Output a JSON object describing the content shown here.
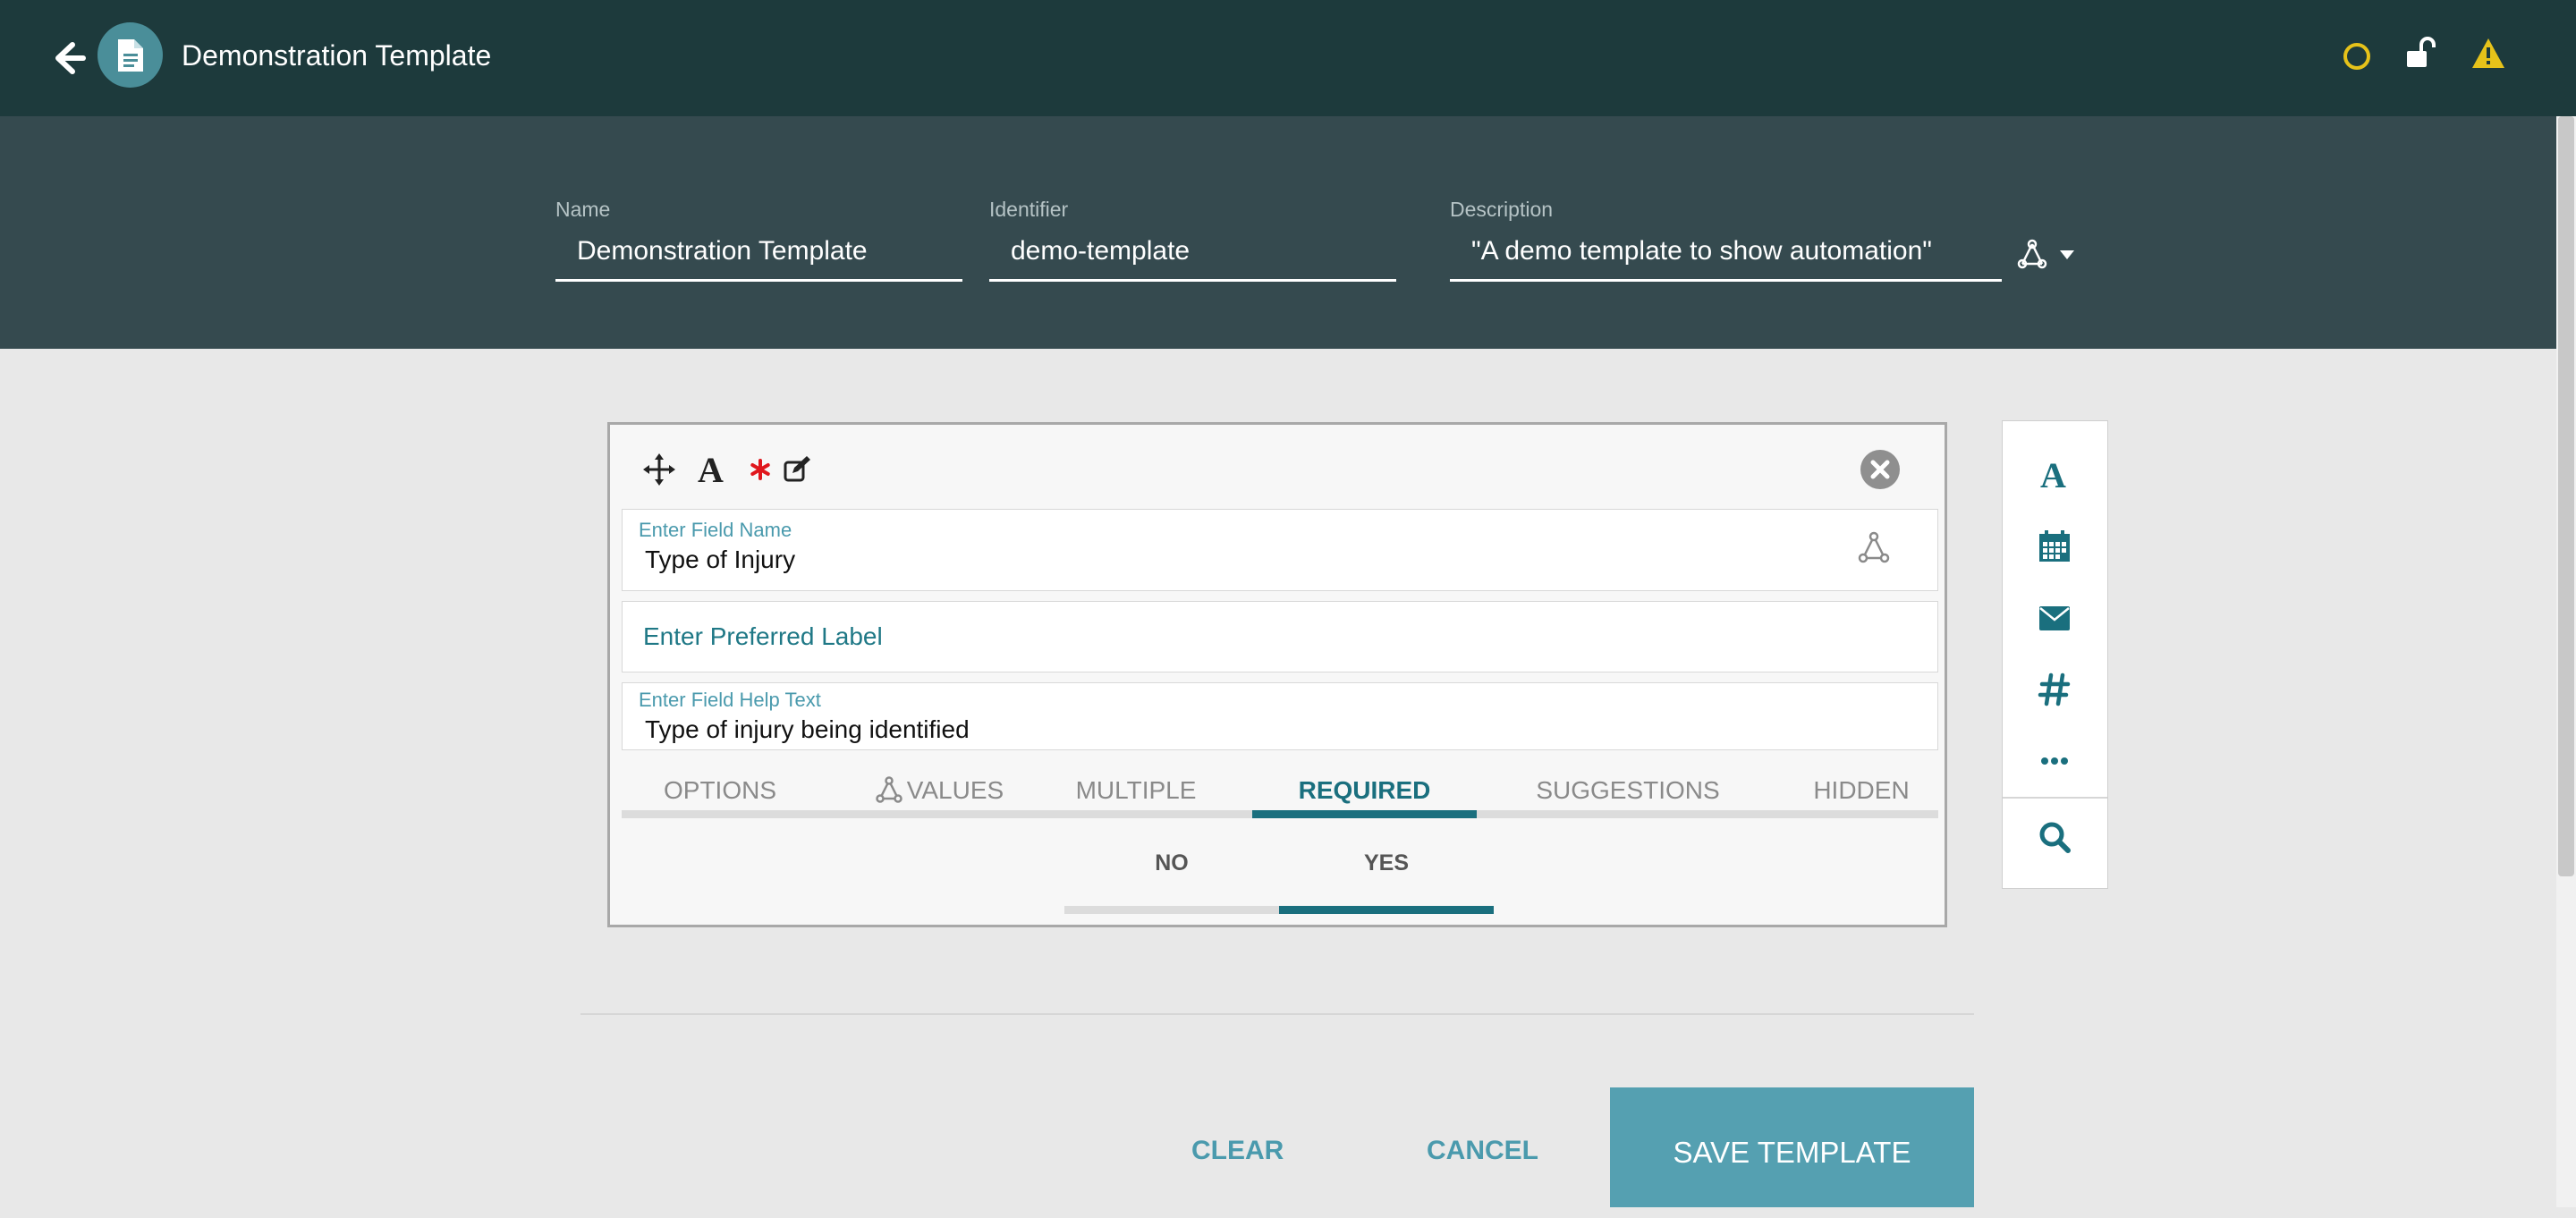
{
  "app": {
    "title": "Demonstration Template",
    "icons": {
      "back": "back-arrow-icon",
      "document": "document-icon",
      "status": "circle-icon",
      "lock": "unlocked-lock-icon",
      "warning": "warning-icon"
    },
    "colors": {
      "topbar": "#1d3a3c",
      "band": "#354a4f",
      "accent": "#1a6f7e",
      "warning": "#e6c21a",
      "button": "#55a0b1"
    }
  },
  "meta": {
    "name_label": "Name",
    "name_value": "Demonstration Template",
    "identifier_label": "Identifier",
    "identifier_value": "demo-template",
    "description_label": "Description",
    "description_value": "\"A demo template to show automation\""
  },
  "field": {
    "name_label": "Enter Field Name",
    "name_value": "Type of Injury",
    "preferred_label_placeholder": "Enter Preferred Label",
    "help_label": "Enter Field Help Text",
    "help_value": "Type of injury being identified",
    "tabs": [
      "OPTIONS",
      "VALUES",
      "MULTIPLE",
      "REQUIRED",
      "SUGGESTIONS",
      "HIDDEN"
    ],
    "active_tab": "REQUIRED",
    "required": {
      "no_label": "NO",
      "yes_label": "YES",
      "selected": "YES"
    }
  },
  "palette": {
    "items": [
      "text-icon",
      "calendar-icon",
      "email-icon",
      "hash-icon",
      "more-icon",
      "search-icon"
    ]
  },
  "footer": {
    "clear": "CLEAR",
    "cancel": "CANCEL",
    "save": "SAVE TEMPLATE"
  }
}
